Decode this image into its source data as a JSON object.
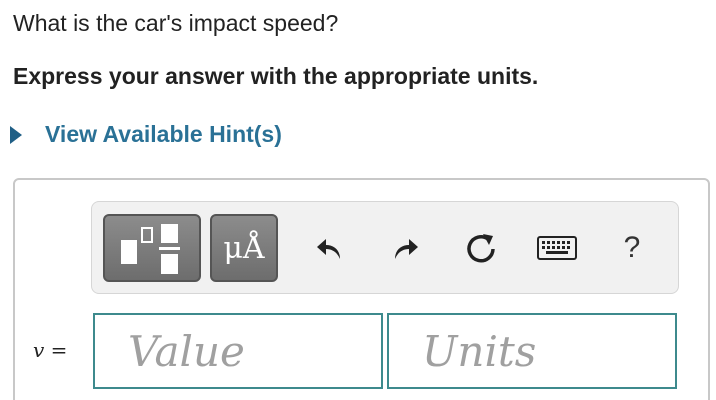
{
  "question": {
    "prompt": "What is the car's impact speed?",
    "instruction": "Express your answer with the appropriate units."
  },
  "hint": {
    "label": "View Available Hint(s)"
  },
  "toolbar": {
    "templates_icon": "templates-icon",
    "units_label": "μÅ",
    "undo_icon": "undo-icon",
    "redo_icon": "redo-icon",
    "reset_icon": "reset-icon",
    "keyboard_icon": "keyboard-icon",
    "help_label": "?"
  },
  "answer": {
    "variable": "v",
    "equals": "=",
    "value_placeholder": "Value",
    "units_placeholder": "Units"
  },
  "colors": {
    "hint_link": "#2a7196",
    "field_border": "#3d8a8d",
    "toolbar_button": "#7c7c7c"
  }
}
